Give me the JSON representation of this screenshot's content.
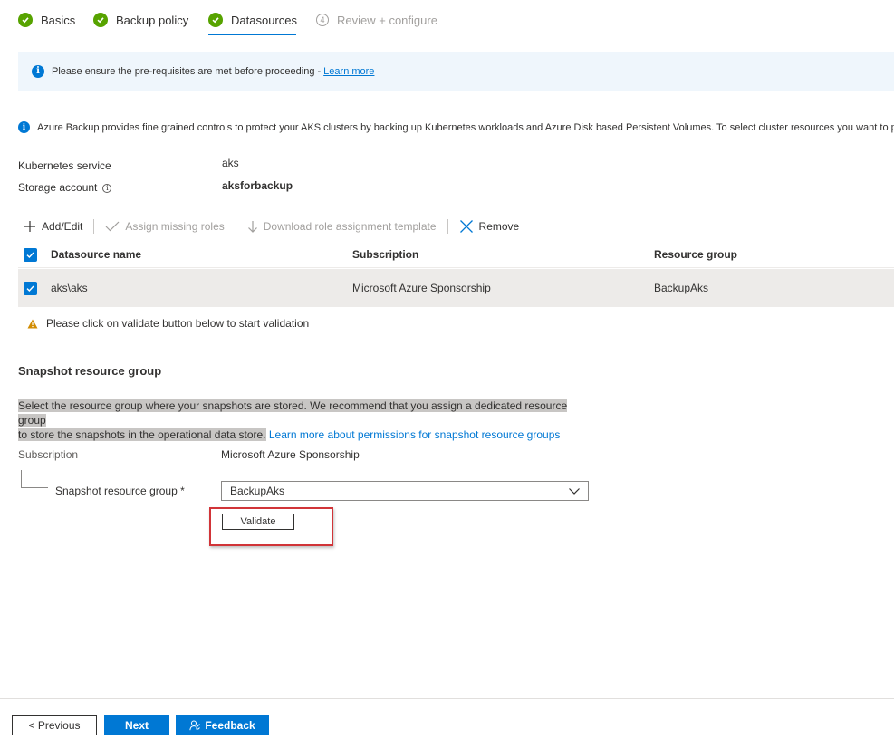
{
  "wizard": {
    "steps": [
      {
        "label": "Basics",
        "state": "complete"
      },
      {
        "label": "Backup policy",
        "state": "complete"
      },
      {
        "label": "Datasources",
        "state": "complete"
      },
      {
        "label": "Review + configure",
        "number": "4",
        "state": "disabled"
      }
    ]
  },
  "banner": {
    "text": "Please ensure the pre-requisites are met before proceeding - ",
    "link": "Learn more"
  },
  "info_text": "Azure Backup provides fine grained controls to protect your AKS clusters by backing up Kubernetes workloads and Azure Disk based Persistent Volumes. To select cluster resources you want to protect",
  "details": {
    "kubernetes_label": "Kubernetes service",
    "kubernetes_value": "aks",
    "storage_label": "Storage account",
    "storage_value": "aksforbackup"
  },
  "toolbar": {
    "add_edit": "Add/Edit",
    "assign_roles": "Assign missing roles",
    "download_template": "Download role assignment template",
    "remove": "Remove"
  },
  "grid": {
    "columns": [
      "Datasource name",
      "Subscription",
      "Resource group"
    ],
    "rows": [
      {
        "name": "aks\\aks",
        "subscription": "Microsoft Azure Sponsorship",
        "resource_group": "BackupAks"
      }
    ]
  },
  "warning": "Please click on validate button below to start validation",
  "snapshot": {
    "title": "Snapshot resource group",
    "desc_line1": "Select the resource group where your snapshots are stored. We recommend that you assign a dedicated resource group",
    "desc_line2": "to store the snapshots in the operational data store.",
    "desc_link": "Learn more about permissions for snapshot resource groups",
    "subscription_label": "Subscription",
    "subscription_value": "Microsoft Azure Sponsorship",
    "rg_label": "Snapshot resource group *",
    "rg_value": "BackupAks",
    "validate": "Validate"
  },
  "footer": {
    "previous": "< Previous",
    "next": "Next",
    "feedback": "Feedback"
  },
  "colors": {
    "accent": "#0078d4",
    "success": "#57a300",
    "warning": "#d18b00",
    "highlight_box": "#d13438"
  }
}
